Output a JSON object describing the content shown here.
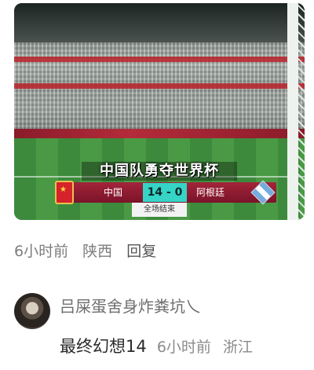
{
  "video": {
    "headline": "中国队勇夺世界杯",
    "team_home": "中国",
    "score": "14 - 0",
    "team_away": "阿根廷",
    "status": "全场结束"
  },
  "post_meta": {
    "time": "6小时前",
    "location": "陕西",
    "reply_label": "回复"
  },
  "comment": {
    "username": "吕屎蛋舍身炸粪坑乀",
    "avatar_icon": "avatar-icon",
    "reply_text": "最终幻想14",
    "time": "6小时前",
    "location": "浙江"
  },
  "colors": {
    "score_bg": "#35d4c6",
    "scorebar_bg": "#a3243a",
    "meta_text": "#7d7d7d"
  }
}
